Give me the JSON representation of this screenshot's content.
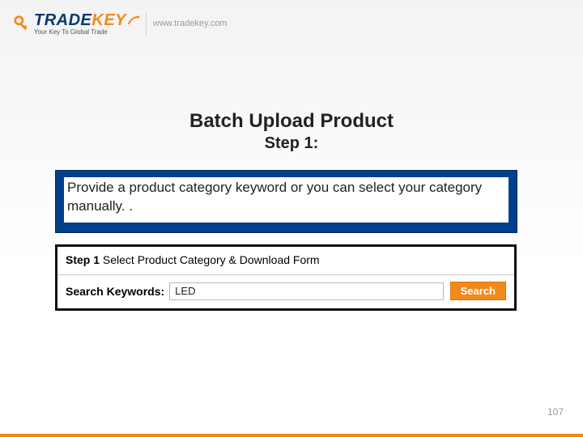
{
  "colors": {
    "brand_orange": "#f28a1a",
    "brand_blue": "#043a6b",
    "callout_blue": "#003f8a"
  },
  "header": {
    "brand_first": "TRADE",
    "brand_second": "KEY",
    "tagline": "Your Key To Global Trade",
    "site_url": "www.tradekey.com"
  },
  "title": {
    "main": "Batch Upload Product",
    "step": "Step 1:"
  },
  "instruction": "Provide a product category keyword or you can select your category manually. .",
  "step_panel": {
    "step_label": "Step 1",
    "step_desc": "Select Product Category & Download Form",
    "search_label": "Search Keywords:",
    "search_value": "LED",
    "search_button": "Search"
  },
  "page_number": "107"
}
